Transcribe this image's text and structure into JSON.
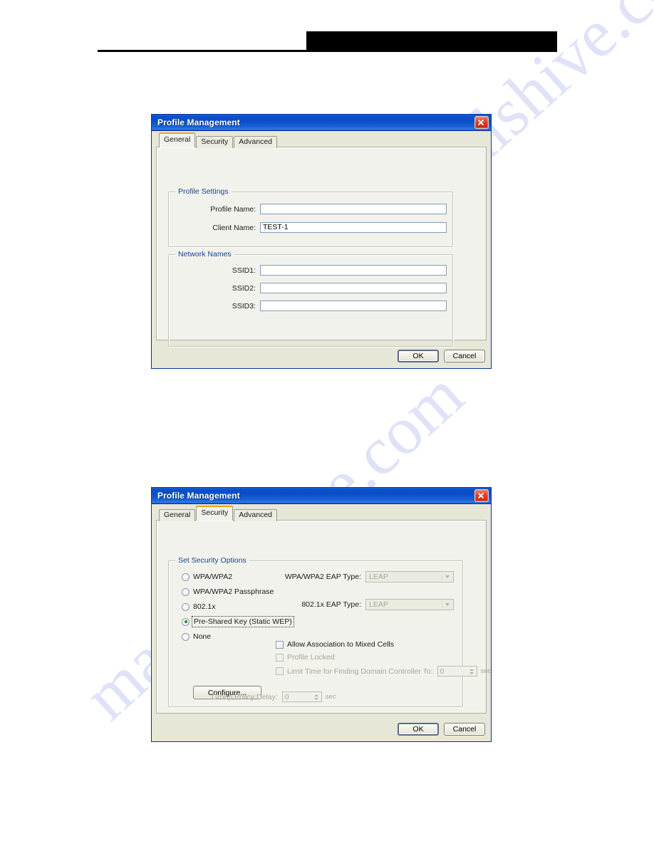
{
  "page": {
    "header": {
      "redaction_present": true,
      "rule_present": true
    },
    "watermark": {
      "text_primary": "manualshive.com",
      "text_secondary": "manualshive.com",
      "color": "#9aa0e8"
    }
  },
  "dialog_general": {
    "title": "Profile Management",
    "close_label": "×",
    "tabs": [
      {
        "label": "General",
        "active": true
      },
      {
        "label": "Security",
        "active": false
      },
      {
        "label": "Advanced",
        "active": false
      }
    ],
    "groups": {
      "profile_settings": {
        "title": "Profile Settings",
        "fields": [
          {
            "label": "Profile Name:",
            "value": "",
            "placeholder": ""
          },
          {
            "label": "Client Name:",
            "value": "TEST-1",
            "placeholder": ""
          }
        ]
      },
      "network_names": {
        "title": "Network Names",
        "fields": [
          {
            "label": "SSID1:",
            "value": "",
            "placeholder": ""
          },
          {
            "label": "SSID2:",
            "value": "",
            "placeholder": ""
          },
          {
            "label": "SSID3:",
            "value": "",
            "placeholder": ""
          }
        ]
      }
    },
    "buttons": {
      "ok": "OK",
      "cancel": "Cancel"
    }
  },
  "dialog_security": {
    "title": "Profile Management",
    "close_label": "×",
    "tabs": [
      {
        "label": "General",
        "active": false
      },
      {
        "label": "Security",
        "active": true
      },
      {
        "label": "Advanced",
        "active": false
      }
    ],
    "group": {
      "title": "Set Security Options",
      "radios": [
        {
          "label": "WPA/WPA2",
          "selected": false,
          "focused": false
        },
        {
          "label": "WPA/WPA2 Passphrase",
          "selected": false,
          "focused": false
        },
        {
          "label": "802.1x",
          "selected": false,
          "focused": false
        },
        {
          "label": "Pre-Shared Key (Static WEP)",
          "selected": true,
          "focused": true
        },
        {
          "label": "None",
          "selected": false,
          "focused": false
        }
      ],
      "combos": [
        {
          "label": "WPA/WPA2 EAP Type:",
          "value": "LEAP",
          "enabled": false
        },
        {
          "label": "802.1x EAP Type:",
          "value": "LEAP",
          "enabled": false
        }
      ],
      "configure_button": "Configure...",
      "checkboxes": [
        {
          "label": "Allow Association to Mixed Cells",
          "checked": false,
          "enabled": true
        },
        {
          "label": "Profile Locked",
          "checked": false,
          "enabled": false
        },
        {
          "label": "Limit Time for Finding Domain Controller To:",
          "checked": false,
          "enabled": false
        }
      ],
      "domain_controller_spinner": {
        "value": "0",
        "unit": "sec",
        "enabled": false
      },
      "group_policy_delay": {
        "label": "Group Policy Delay:",
        "value": "0",
        "unit": "sec",
        "enabled": false
      }
    },
    "buttons": {
      "ok": "OK",
      "cancel": "Cancel"
    }
  }
}
